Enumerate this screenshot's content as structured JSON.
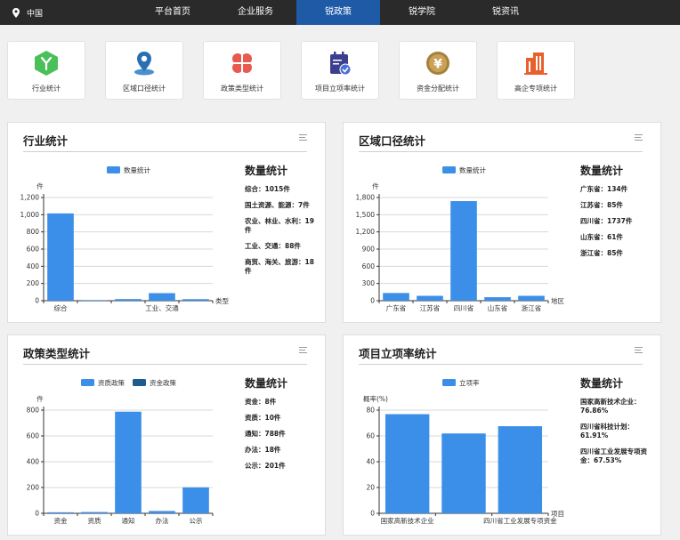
{
  "nav": {
    "location": "中国",
    "items": [
      "平台首页",
      "企业服务",
      "锐政策",
      "锐学院",
      "锐资讯"
    ],
    "active_index": 2,
    "active_color": "#1f5aa6"
  },
  "tiles": [
    {
      "label": "行业统计",
      "icon": "hexagon-y-icon",
      "color": "#4bbf5a"
    },
    {
      "label": "区域口径统计",
      "icon": "map-pin-icon",
      "color": "#2a6fb3"
    },
    {
      "label": "政策类型统计",
      "icon": "clover-icon",
      "color": "#e85a4f"
    },
    {
      "label": "项目立项率统计",
      "icon": "calendar-check-icon",
      "color": "#3b3f8f"
    },
    {
      "label": "资金分配统计",
      "icon": "yen-coin-icon",
      "color": "#a5813a"
    },
    {
      "label": "高企专项统计",
      "icon": "building-icon",
      "color": "#e8602c"
    }
  ],
  "panels": {
    "industry": {
      "title": "行业统计",
      "stat_title": "数量统计",
      "stats": [
        "综合：1015件",
        "国土资源、能源：7件",
        "农业、林业、水利：19件",
        "工业、交通：88件",
        "商贸、海关、旅游：18件"
      ]
    },
    "region": {
      "title": "区域口径统计",
      "stat_title": "数量统计",
      "stats": [
        "广东省：134件",
        "江苏省：85件",
        "四川省：1737件",
        "山东省：61件",
        "浙江省：85件"
      ]
    },
    "policy": {
      "title": "政策类型统计",
      "stat_title": "数量统计",
      "stats": [
        "资金：8件",
        "资质：10件",
        "通知：788件",
        "办法：18件",
        "公示：201件"
      ]
    },
    "project": {
      "title": "项目立项率统计",
      "stat_title": "数量统计",
      "stats": [
        "国家高新技术企业：76.86%",
        "四川省科技计划：61.91%",
        "四川省工业发展专项资金：67.53%"
      ]
    }
  },
  "chart_data": [
    {
      "type": "bar",
      "legend": [
        "数量统计"
      ],
      "ylabel": "件",
      "xlabel": "类型",
      "ylim": [
        0,
        1200
      ],
      "yticks": [
        "0",
        "200",
        "400",
        "600",
        "800",
        "1,000",
        "1,200"
      ],
      "categories": [
        "综合",
        "国土资源、能源",
        "农业、林业、水利",
        "工业、交通",
        "商贸、海关、旅游"
      ],
      "x_tick_labels": [
        "综合",
        "",
        "",
        "工业、交通",
        ""
      ],
      "series": [
        {
          "name": "数量统计",
          "values": [
            1015,
            7,
            19,
            88,
            18
          ]
        }
      ],
      "colors": [
        "#3c8fe8"
      ]
    },
    {
      "type": "bar",
      "legend": [
        "数量统计"
      ],
      "ylabel": "件",
      "xlabel": "地区",
      "ylim": [
        0,
        1800
      ],
      "yticks": [
        "0",
        "300",
        "600",
        "900",
        "1,200",
        "1,500",
        "1,800"
      ],
      "categories": [
        "广东省",
        "江苏省",
        "四川省",
        "山东省",
        "浙江省"
      ],
      "x_tick_labels": [
        "广东省",
        "江苏省",
        "四川省",
        "山东省",
        "浙江省"
      ],
      "series": [
        {
          "name": "数量统计",
          "values": [
            134,
            85,
            1737,
            61,
            85
          ]
        }
      ],
      "colors": [
        "#3c8fe8"
      ]
    },
    {
      "type": "bar",
      "legend": [
        "资质政策",
        "资金政策"
      ],
      "ylabel": "件",
      "xlabel": "",
      "ylim": [
        0,
        800
      ],
      "yticks": [
        "0",
        "200",
        "400",
        "600",
        "800"
      ],
      "categories": [
        "资金",
        "资质",
        "通知",
        "办法",
        "公示"
      ],
      "x_tick_labels": [
        "资金",
        "资质",
        "通知",
        "办法",
        "公示"
      ],
      "series": [
        {
          "name": "资质政策",
          "values": [
            8,
            10,
            788,
            18,
            201
          ]
        }
      ],
      "colors": [
        "#3c8fe8",
        "#1f5b8e"
      ]
    },
    {
      "type": "bar",
      "legend": [
        "立项率"
      ],
      "ylabel": "概率(%)",
      "xlabel": "项目",
      "ylim": [
        0,
        80
      ],
      "yticks": [
        "0",
        "20",
        "40",
        "60",
        "80"
      ],
      "categories": [
        "国家高新技术企业",
        "四川省科技计划",
        "四川省工业发展专项资金"
      ],
      "x_tick_labels": [
        "国家高新技术企业",
        "",
        "四川省工业发展专项资金"
      ],
      "series": [
        {
          "name": "立项率",
          "values": [
            76.86,
            61.91,
            67.53
          ]
        }
      ],
      "colors": [
        "#3c8fe8"
      ]
    }
  ]
}
